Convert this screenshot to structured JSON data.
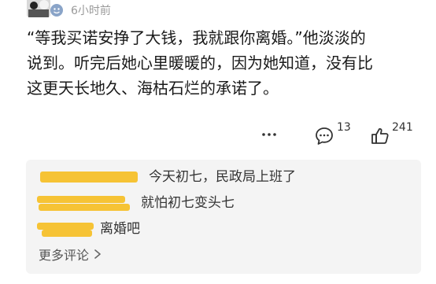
{
  "header": {
    "timestamp": "6小时前",
    "avatar_icon": "panda-avatar-icon",
    "badge_icon": "smiley-badge-icon"
  },
  "post": {
    "lines": [
      "“等我买诺安挣了大钱，我就跟你离婚。”他淡淡的",
      "说到。听完后她心里暖暖的，因为她知道，没有比",
      "这更天长地久、海枯石烂的承诺了。"
    ]
  },
  "actions": {
    "more_icon": "more-dots-icon",
    "comment_icon": "comment-bubble-icon",
    "comment_count": "13",
    "like_icon": "thumbs-up-icon",
    "like_count": "241"
  },
  "comments": {
    "items": [
      {
        "text": "今天初七，民政局上班了"
      },
      {
        "text": "就怕初七变头七"
      },
      {
        "text": "离婚吧"
      }
    ],
    "more_label": "更多评论",
    "redaction_color": "#f5c02a"
  }
}
